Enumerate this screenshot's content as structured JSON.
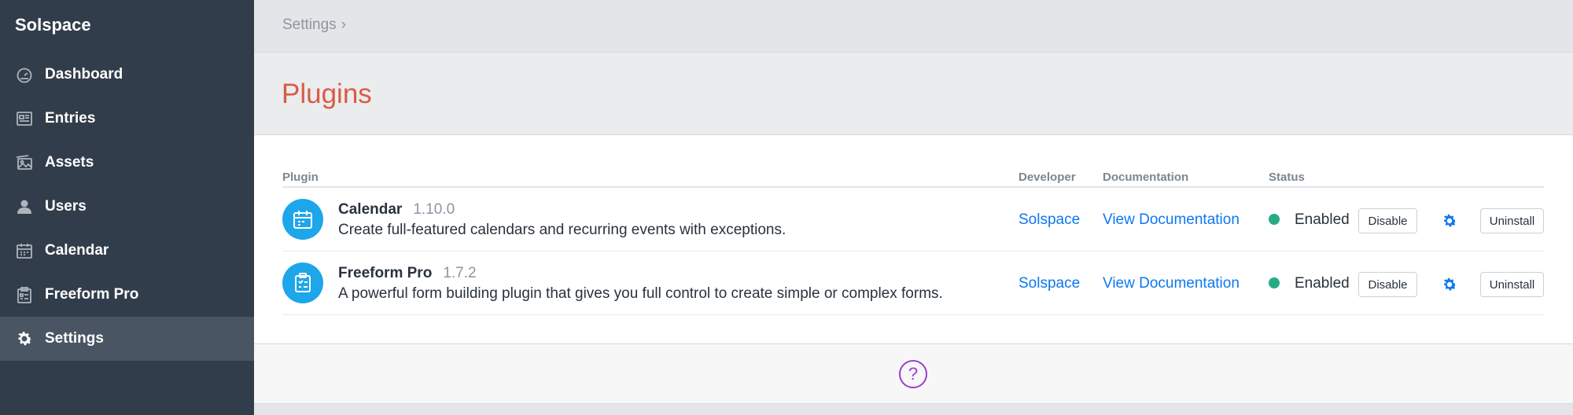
{
  "sidebar": {
    "brand": "Solspace",
    "items": [
      {
        "label": "Dashboard",
        "icon": "dashboard-icon"
      },
      {
        "label": "Entries",
        "icon": "entries-icon"
      },
      {
        "label": "Assets",
        "icon": "assets-icon"
      },
      {
        "label": "Users",
        "icon": "users-icon"
      },
      {
        "label": "Calendar",
        "icon": "calendar-icon"
      },
      {
        "label": "Freeform Pro",
        "icon": "freeform-icon"
      },
      {
        "label": "Settings",
        "icon": "gear-icon",
        "active": true
      }
    ]
  },
  "breadcrumb": {
    "label": "Settings",
    "separator": "›"
  },
  "page": {
    "title": "Plugins"
  },
  "table": {
    "headers": {
      "plugin": "Plugin",
      "developer": "Developer",
      "documentation": "Documentation",
      "status": "Status"
    },
    "rows": [
      {
        "name": "Calendar",
        "version": "1.10.0",
        "description": "Create full-featured calendars and recurring events with exceptions.",
        "developer": "Solspace",
        "documentation": "View Documentation",
        "status": "Enabled",
        "disable_label": "Disable",
        "uninstall_label": "Uninstall",
        "icon": "calendar-icon"
      },
      {
        "name": "Freeform Pro",
        "version": "1.7.2",
        "description": "A powerful form building plugin that gives you full control to create simple or complex forms.",
        "developer": "Solspace",
        "documentation": "View Documentation",
        "status": "Enabled",
        "disable_label": "Disable",
        "uninstall_label": "Uninstall",
        "icon": "clipboard-icon"
      }
    ]
  },
  "footer": {
    "help_label": "?"
  },
  "colors": {
    "sidebar_bg": "#323d4b",
    "active_item_bg": "#4a5563",
    "title_red": "#da5a47",
    "link_blue": "#0d78f2",
    "status_green": "#27ab83",
    "plugin_icon_blue": "#1ea6ea",
    "help_purple": "#9b40c9"
  }
}
